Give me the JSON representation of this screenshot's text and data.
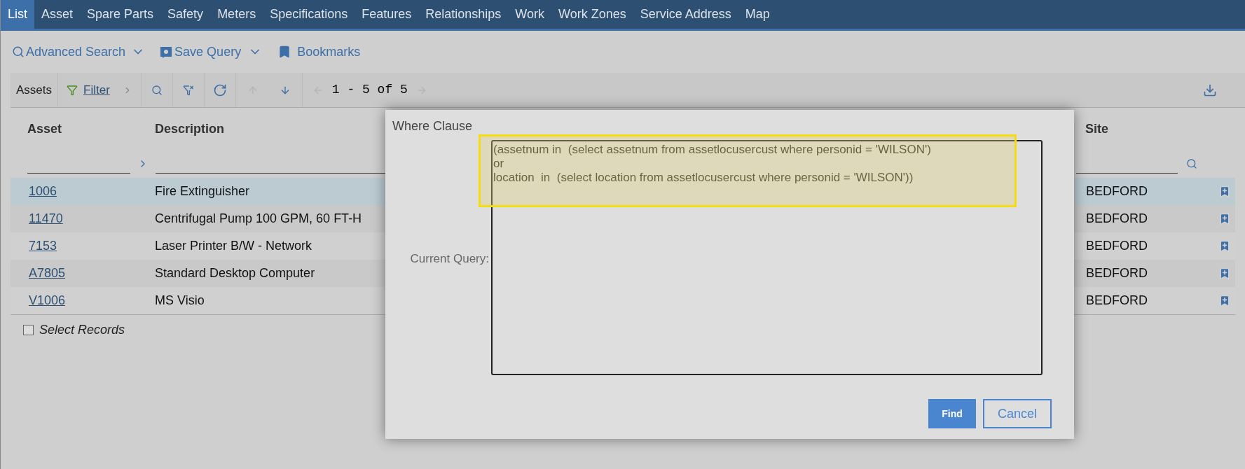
{
  "nav_tabs": [
    {
      "label": "List",
      "selected": true
    },
    {
      "label": "Asset",
      "selected": false
    },
    {
      "label": "Spare Parts",
      "selected": false
    },
    {
      "label": "Safety",
      "selected": false
    },
    {
      "label": "Meters",
      "selected": false
    },
    {
      "label": "Specifications",
      "selected": false
    },
    {
      "label": "Features",
      "selected": false
    },
    {
      "label": "Relationships",
      "selected": false
    },
    {
      "label": "Work",
      "selected": false
    },
    {
      "label": "Work Zones",
      "selected": false
    },
    {
      "label": "Service Address",
      "selected": false
    },
    {
      "label": "Map",
      "selected": false
    }
  ],
  "toolbar": {
    "advanced_search": "Advanced Search",
    "save_query": "Save Query",
    "bookmarks": "Bookmarks"
  },
  "table_toolbar": {
    "title": "Assets",
    "filter": "Filter",
    "pagination": "1 - 5 of 5"
  },
  "table": {
    "columns": [
      "Asset",
      "Description",
      "Site"
    ],
    "rows": [
      {
        "asset": "1006",
        "description": "Fire Extinguisher",
        "site": "BEDFORD",
        "selected": true
      },
      {
        "asset": "11470",
        "description": "Centrifugal Pump 100 GPM, 60 FT-H",
        "site": "BEDFORD",
        "selected": false
      },
      {
        "asset": "7153",
        "description": "Laser Printer B/W - Network",
        "site": "BEDFORD",
        "selected": false
      },
      {
        "asset": "A7805",
        "description": "Standard Desktop Computer",
        "site": "BEDFORD",
        "selected": false
      },
      {
        "asset": "V1006",
        "description": "MS Visio",
        "site": "BEDFORD",
        "selected": false
      }
    ]
  },
  "select_records": {
    "label": "Select Records",
    "checked": false
  },
  "dialog": {
    "title": "Where Clause",
    "query_label": "Current Query:",
    "query": "(assetnum in  (select assetnum from assetlocusercust where personid = 'WILSON')\nor\nlocation  in  (select location from assetlocusercust where personid = 'WILSON'))",
    "highlighted": true,
    "buttons": [
      {
        "label": "Find",
        "kind": "primary"
      },
      {
        "label": "Cancel",
        "kind": "secondary"
      }
    ]
  }
}
